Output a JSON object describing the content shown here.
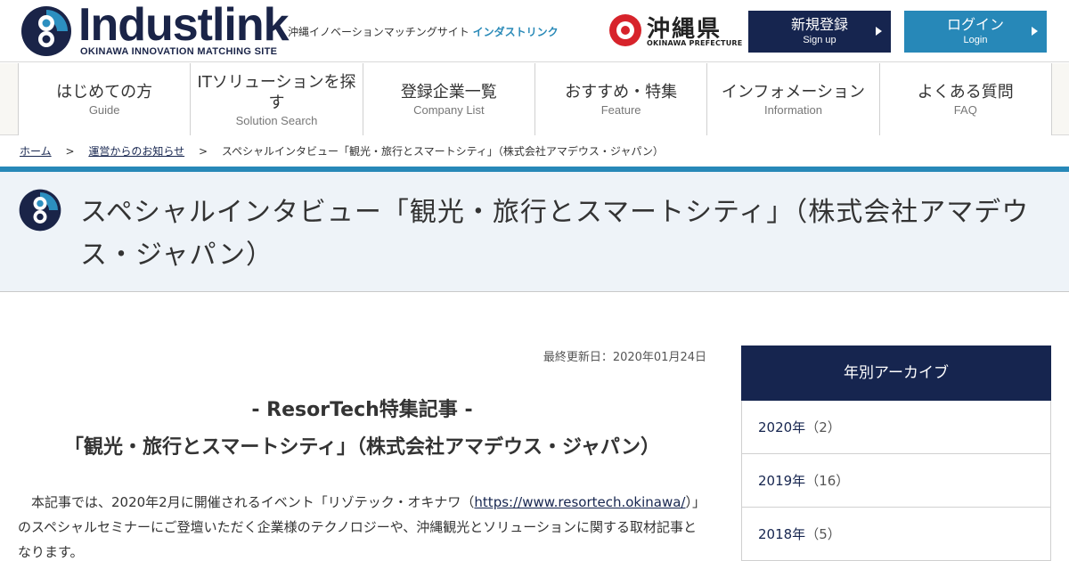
{
  "header": {
    "logo_word": "Industlink",
    "logo_sub": "OKINAWA INNOVATION MATCHING SITE",
    "tagline_prefix": "沖縄イノベーションマッチングサイト",
    "tagline_name": "インダストリンク",
    "prefecture_name": "沖縄県",
    "prefecture_en": "OKINAWA PREFECTURE",
    "signup_label": "新規登録",
    "signup_sub": "Sign up",
    "login_label": "ログイン",
    "login_sub": "Login"
  },
  "nav": {
    "items": [
      {
        "jp": "はじめての方",
        "en": "Guide"
      },
      {
        "jp": "ITソリューションを探す",
        "en": "Solution Search"
      },
      {
        "jp": "登録企業一覧",
        "en": "Company List"
      },
      {
        "jp": "おすすめ・特集",
        "en": "Feature"
      },
      {
        "jp": "インフォメーション",
        "en": "Information"
      },
      {
        "jp": "よくある質問",
        "en": "FAQ"
      }
    ]
  },
  "breadcrumb": {
    "home": "ホーム",
    "sep": ">",
    "parent": "運営からのお知らせ",
    "current": "スペシャルインタビュー「観光・旅行とスマートシティ」（株式会社アマデウス・ジャパン）"
  },
  "page": {
    "title": "スペシャルインタビュー「観光・旅行とスマートシティ」（株式会社アマデウス・ジャパン）"
  },
  "article": {
    "updated": "最終更新日：2020年01月24日",
    "heading_line1": "- ResorTech特集記事 -",
    "heading_line2": "「観光・旅行とスマートシティ」（株式会社アマデウス・ジャパン）",
    "body_before_link": "本記事では、2020年2月に開催されるイベント「リゾテック・オキナワ（",
    "body_link": "https://www.resortech.okinawa/",
    "body_after_link": "）」のスペシャルセミナーにご登壇いただく企業様のテクノロジーや、沖縄観光とソリューションに関する取材記事となります。"
  },
  "sidebar": {
    "heading": "年別アーカイブ",
    "items": [
      {
        "year": "2020年",
        "count": "（2）"
      },
      {
        "year": "2019年",
        "count": "（16）"
      },
      {
        "year": "2018年",
        "count": "（5）"
      }
    ]
  },
  "colors": {
    "navy": "#16254f",
    "blue": "#2788b8",
    "red": "#d7232b",
    "title_band": "#eef3f8"
  },
  "icons": {
    "logo": "industlink-logo-icon",
    "title": "industlink-logo-icon",
    "button_arrow": "triangle-right-icon"
  }
}
